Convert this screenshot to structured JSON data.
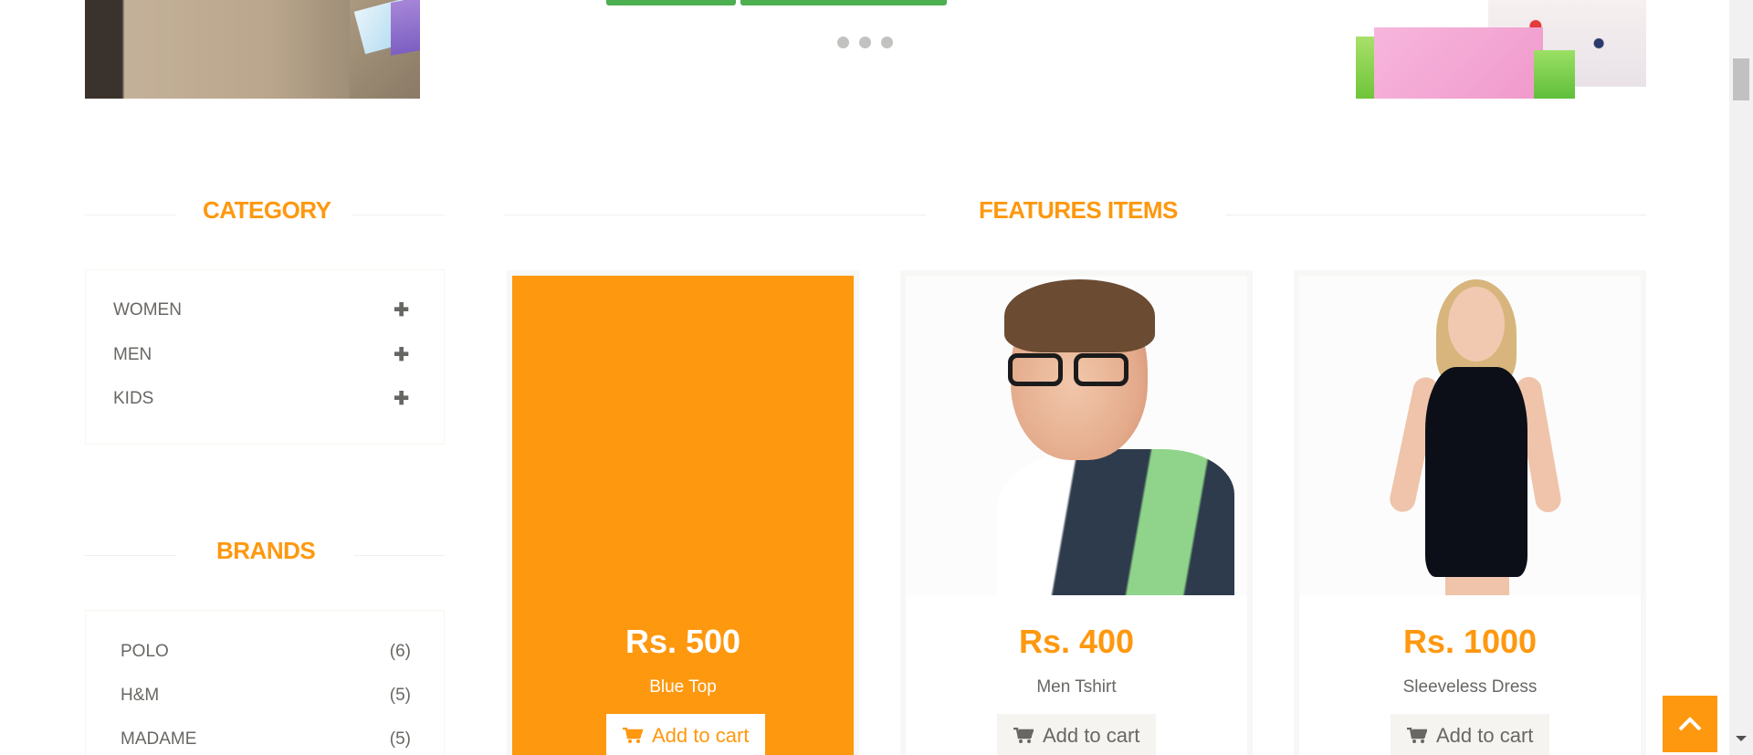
{
  "slider": {
    "dots_count": 3
  },
  "category": {
    "title": "CATEGORY",
    "items": [
      {
        "label": "WOMEN"
      },
      {
        "label": "MEN"
      },
      {
        "label": "KIDS"
      }
    ]
  },
  "brands": {
    "title": "BRANDS",
    "items": [
      {
        "label": "POLO",
        "count": "(6)"
      },
      {
        "label": "H&M",
        "count": "(5)"
      },
      {
        "label": "MADAME",
        "count": "(5)"
      }
    ]
  },
  "features": {
    "title": "FEATURES ITEMS",
    "products": [
      {
        "price": "Rs. 500",
        "name": "Blue Top",
        "button": "Add to cart"
      },
      {
        "price": "Rs. 400",
        "name": "Men Tshirt",
        "button": "Add to cart"
      },
      {
        "price": "Rs. 1000",
        "name": "Sleeveless Dress",
        "button": "Add to cart"
      }
    ]
  },
  "colors": {
    "accent": "#fe980f",
    "slider_button": "#4caf50",
    "text": "#696763"
  }
}
